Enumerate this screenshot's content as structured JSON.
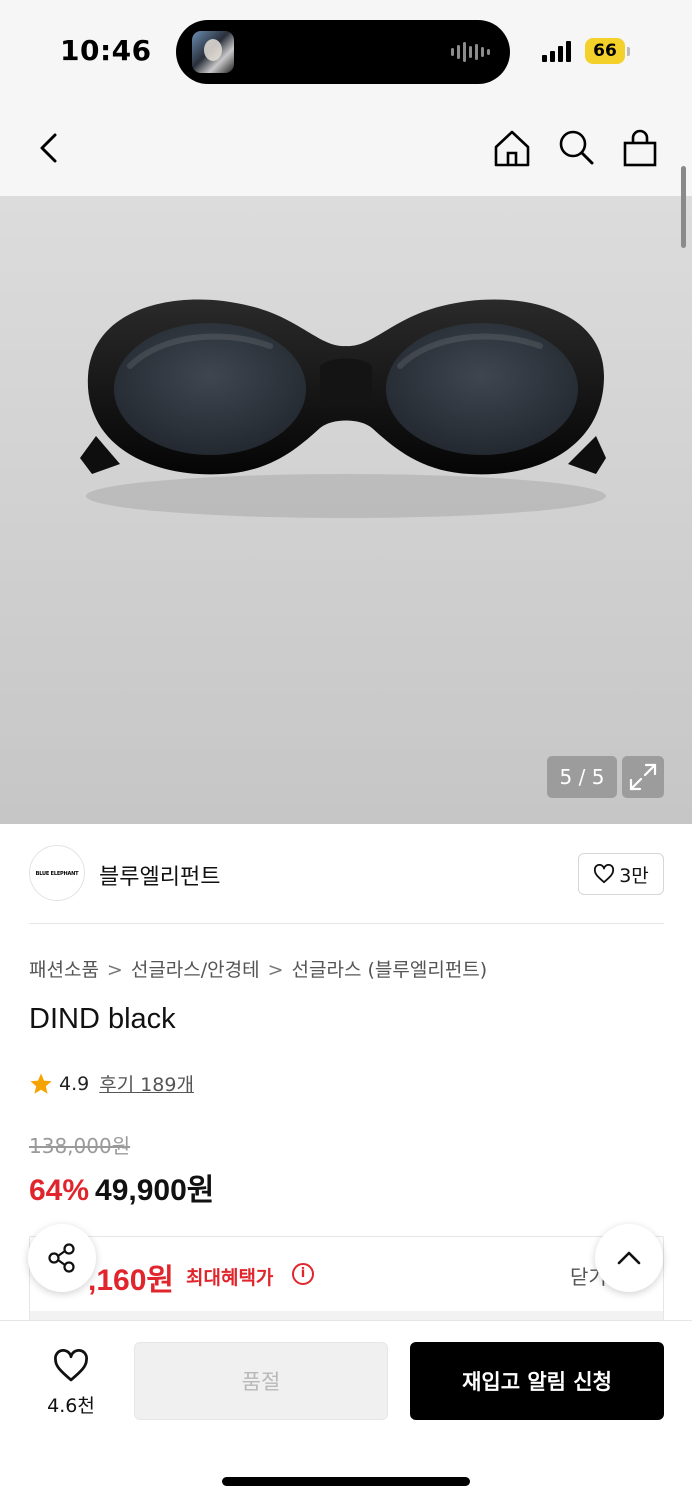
{
  "status_bar": {
    "time": "10:46",
    "battery": "66"
  },
  "nav": {
    "back_icon": "chevron-left-icon",
    "home_icon": "home-icon",
    "search_icon": "search-icon",
    "cart_icon": "shopping-bag-icon"
  },
  "gallery": {
    "counter": "5 / 5",
    "image": "black oval sunglasses",
    "expand_icon": "expand-icon"
  },
  "brand": {
    "logo_text": "BLUE ELEPHANT",
    "name": "블루엘리펀트",
    "follow_count": "3만"
  },
  "breadcrumb": [
    "패션소품",
    "선글라스/안경테",
    "선글라스 (블루엘리펀트)"
  ],
  "product": {
    "title": "DIND black",
    "rating": "4.9",
    "reviews": "후기 189개",
    "original_price": "138,000원",
    "discount": "64%",
    "sale_price": "49,900원"
  },
  "benefit": {
    "amount": ",160원",
    "label": "최대혜택가",
    "close": "닫기"
  },
  "bottom_bar": {
    "wish_count": "4.6천",
    "soldout_label": "품절",
    "restock_label": "재입고 알림 신청"
  },
  "colors": {
    "accent_red": "#e0262c",
    "primary_black": "#000000",
    "battery_yellow": "#f3d02a"
  }
}
